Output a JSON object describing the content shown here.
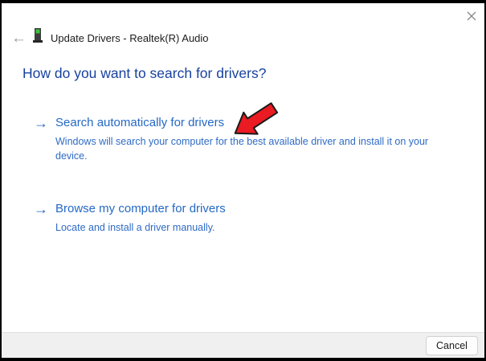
{
  "window": {
    "title": "Update Drivers - Realtek(R) Audio",
    "back_icon": "←",
    "close_icon": "close-x"
  },
  "heading": "How do you want to search for drivers?",
  "options": [
    {
      "arrow": "→",
      "title": "Search automatically for drivers",
      "description": "Windows will search your computer for the best available driver and install it on your device."
    },
    {
      "arrow": "→",
      "title": "Browse my computer for drivers",
      "description": "Locate and install a driver manually."
    }
  ],
  "annotation": {
    "type": "red-arrow",
    "points_to": "Search automatically for drivers"
  },
  "footer": {
    "cancel_label": "Cancel"
  },
  "colors": {
    "heading_blue": "#17419f",
    "link_blue": "#2569c5",
    "description_blue": "#2e6bc6",
    "annotation_red": "#ea1b22",
    "footer_bg": "#f0f0f0",
    "border_black": "#000000"
  }
}
